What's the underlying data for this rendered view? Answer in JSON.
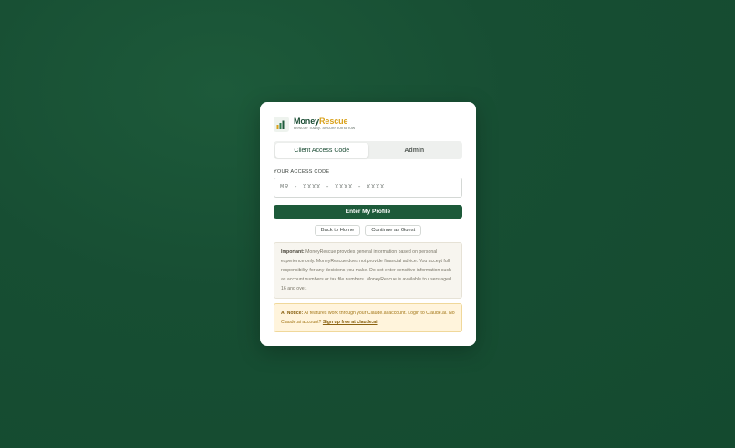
{
  "brand": {
    "name_part1": "Money",
    "name_part2": "Rescue",
    "tagline": "Rescue Today. Secure Tomorrow",
    "icon": "bar-chart-icon",
    "colors": {
      "primary": "#1d5a3a",
      "accent": "#d9a11b"
    }
  },
  "tabs": [
    {
      "label": "Client Access Code",
      "active": true
    },
    {
      "label": "Admin",
      "active": false
    }
  ],
  "access": {
    "label": "YOUR ACCESS CODE",
    "placeholder": "MR - XXXX - XXXX - XXXX",
    "submit_label": "Enter My Profile"
  },
  "secondary": {
    "back_label": "Back to Home",
    "guest_label": "Continue as Guest"
  },
  "important": {
    "title": "Important:",
    "text": "MoneyRescue provides general information based on personal experience only. MoneyRescue does not provide financial advice. You accept full responsibility for any decisions you make. Do not enter sensitive information such as account numbers or tax file numbers. MoneyRescue is available to users aged 16 and over."
  },
  "ai_notice": {
    "title": "AI Notice:",
    "text": "AI features work through your Claude.ai account. Login to Claude.ai. No Claude.ai account?",
    "link_label": "Sign up free at claude.ai",
    "trailing": "."
  }
}
